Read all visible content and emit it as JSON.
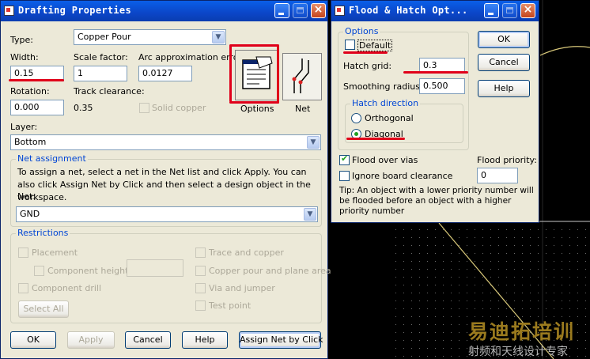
{
  "drafting": {
    "title": "Drafting Properties",
    "type_label": "Type:",
    "type_value": "Copper Pour",
    "width_label": "Width:",
    "width_value": "0.15",
    "scale_label": "Scale factor:",
    "scale_value": "1",
    "arc_label": "Arc approximation error:",
    "arc_value": "0.0127",
    "rotation_label": "Rotation:",
    "rotation_value": "0.000",
    "track_label": "Track clearance:",
    "track_value": "0.35",
    "solid_copper_label": "Solid copper",
    "options_label": "Options",
    "net_btn_label": "Net",
    "layer_label": "Layer:",
    "layer_value": "Bottom",
    "net_assignment_title": "Net assignment",
    "net_assignment_text": "To assign a net, select a net in the Net list and click Apply. You can also click Assign Net by Click and then select a design object in the workspace.",
    "net_label": "Net:",
    "net_value": "GND",
    "restrictions_title": "Restrictions",
    "restrictions": {
      "placement": "Placement",
      "component_height": "Component height",
      "component_drill": "Component drill",
      "trace_copper": "Trace and copper",
      "copper_pour_plane": "Copper pour and plane area",
      "via_jumper": "Via and jumper",
      "test_point": "Test point",
      "select_all": "Select All"
    },
    "buttons": {
      "ok": "OK",
      "apply": "Apply",
      "cancel": "Cancel",
      "help": "Help",
      "assign": "Assign Net by Click"
    }
  },
  "flood": {
    "title": "Flood & Hatch Opt...",
    "options_title": "Options",
    "default_label": "Default",
    "hatch_grid_label": "Hatch grid:",
    "hatch_grid_value": "0.3",
    "smoothing_label": "Smoothing radius:",
    "smoothing_value": "0.500",
    "hatch_direction_title": "Hatch direction",
    "orthogonal_label": "Orthogonal",
    "diagonal_label": "Diagonal",
    "flood_vias_label": "Flood over vias",
    "ignore_board_label": "Ignore board clearance",
    "flood_priority_label": "Flood priority:",
    "flood_priority_value": "0",
    "tip_text": "Tip: An object with a lower priority number will be flooded before an object with a higher priority number",
    "buttons": {
      "ok": "OK",
      "cancel": "Cancel",
      "help": "Help"
    }
  },
  "watermark": {
    "line1": "易迪拓培训",
    "line2": "射频和天线设计专家"
  },
  "colors": {
    "title_bar": "#0b46c8",
    "dialog_bg": "#ece9d8",
    "group_label": "#0046d5",
    "annotation_red": "#e0001a",
    "pcb_bg": "#000000",
    "pcb_line": "#d8c87a"
  }
}
